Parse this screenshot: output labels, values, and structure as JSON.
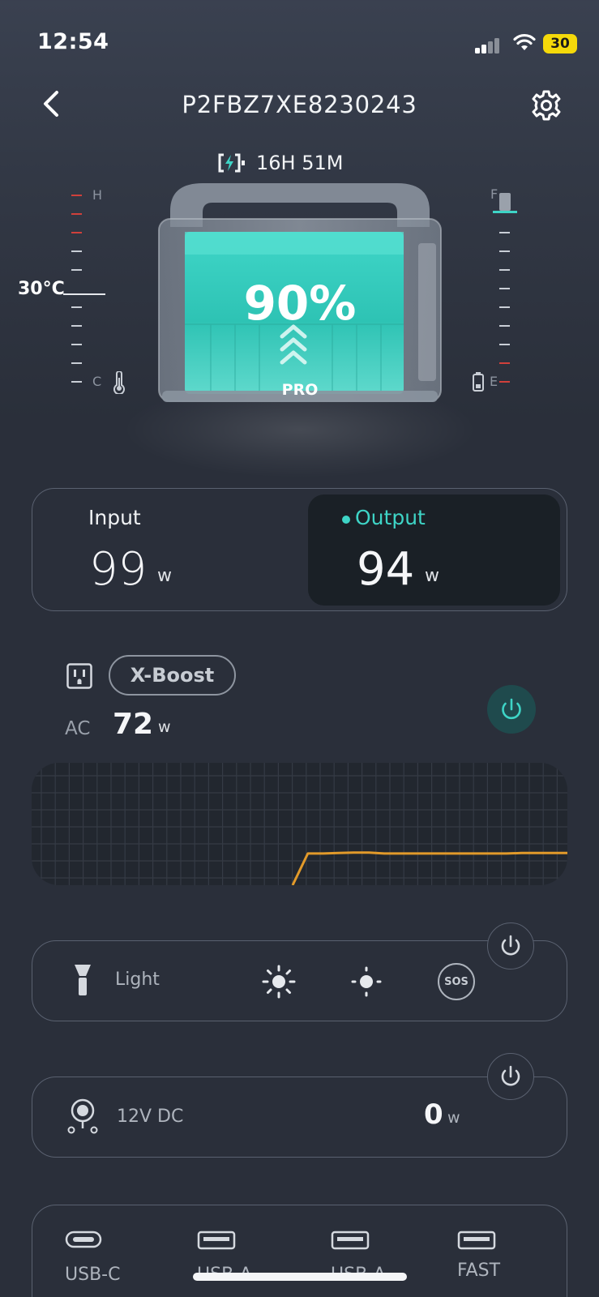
{
  "status_bar": {
    "time": "12:54",
    "battery": "30"
  },
  "header": {
    "title": "P2FBZ7XE8230243"
  },
  "device": {
    "charge_time": "16H 51M",
    "battery_percent": "90%",
    "model_badge": "PRO",
    "temperature": "30°C",
    "temp_gauge": {
      "high": "H",
      "low": "C"
    },
    "fuel_gauge": {
      "full": "F",
      "empty": "E"
    }
  },
  "io": {
    "input_label": "Input",
    "input_value": "99",
    "input_unit": "w",
    "output_label": "Output",
    "output_value": "94",
    "output_unit": "w"
  },
  "ac": {
    "xboost_label": "X-Boost",
    "label": "AC",
    "value": "72",
    "unit": "w",
    "power_on": true
  },
  "chart_data": {
    "type": "line",
    "series": [
      {
        "values": [
          0,
          72,
          72,
          73,
          74,
          74,
          72,
          72,
          72,
          72,
          72,
          72,
          72,
          72,
          72,
          73,
          73,
          73,
          73
        ]
      }
    ],
    "colors": {
      "line": "#e29a2a"
    }
  },
  "light": {
    "label": "Light",
    "sos": "SOS"
  },
  "dc": {
    "label": "12V DC",
    "value": "0",
    "unit": "w"
  },
  "usb": {
    "ports": [
      {
        "label": "USB-C",
        "icon": "usb-c-icon"
      },
      {
        "label": "USB-A",
        "icon": "usb-a-icon"
      },
      {
        "label": "USB-A",
        "icon": "usb-a-icon"
      },
      {
        "label": "FAST",
        "icon": "usb-a-icon"
      }
    ]
  },
  "colors": {
    "accent": "#3ed4c6",
    "alert": "#d0403b",
    "chart_line": "#e29a2a"
  }
}
